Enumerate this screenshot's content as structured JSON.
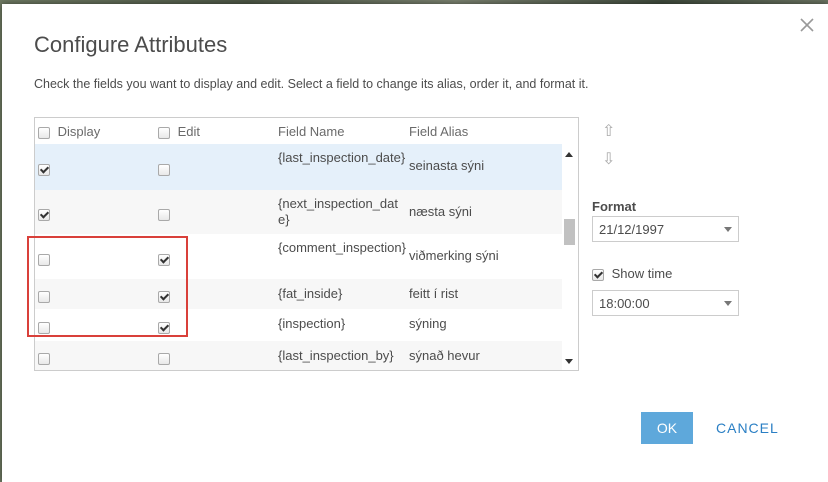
{
  "dialog": {
    "title": "Configure Attributes",
    "description": "Check the fields you want to display and edit. Select a field to change its alias, order it, and format it."
  },
  "grid": {
    "columns": [
      "Display",
      "Edit",
      "Field Name",
      "Field Alias"
    ],
    "rows": [
      {
        "display": true,
        "edit": false,
        "field_name": "{last_inspection_date}",
        "alias": "seinasta sýni",
        "selected": true
      },
      {
        "display": true,
        "edit": false,
        "field_name": "{next_inspection_date}",
        "alias": "næsta sýni",
        "selected": false
      },
      {
        "display": false,
        "edit": true,
        "field_name": "{comment_inspection}",
        "alias": "viðmerking sýni",
        "selected": false
      },
      {
        "display": false,
        "edit": true,
        "field_name": "{fat_inside}",
        "alias": "feitt í rist",
        "selected": false
      },
      {
        "display": false,
        "edit": true,
        "field_name": "{inspection}",
        "alias": "sýning",
        "selected": false
      },
      {
        "display": false,
        "edit": false,
        "field_name": "{last_inspection_by}",
        "alias": "sýnað hevur",
        "selected": false
      }
    ]
  },
  "format": {
    "label": "Format",
    "date_value": "21/12/1997",
    "show_time_label": "Show time",
    "show_time_checked": true,
    "time_value": "18:00:00"
  },
  "buttons": {
    "ok": "OK",
    "cancel": "CANCEL"
  },
  "colors": {
    "accent": "#5ea8db",
    "selected_row": "#e5f0fa",
    "highlight": "#d9403a",
    "link": "#2a7fc4"
  }
}
